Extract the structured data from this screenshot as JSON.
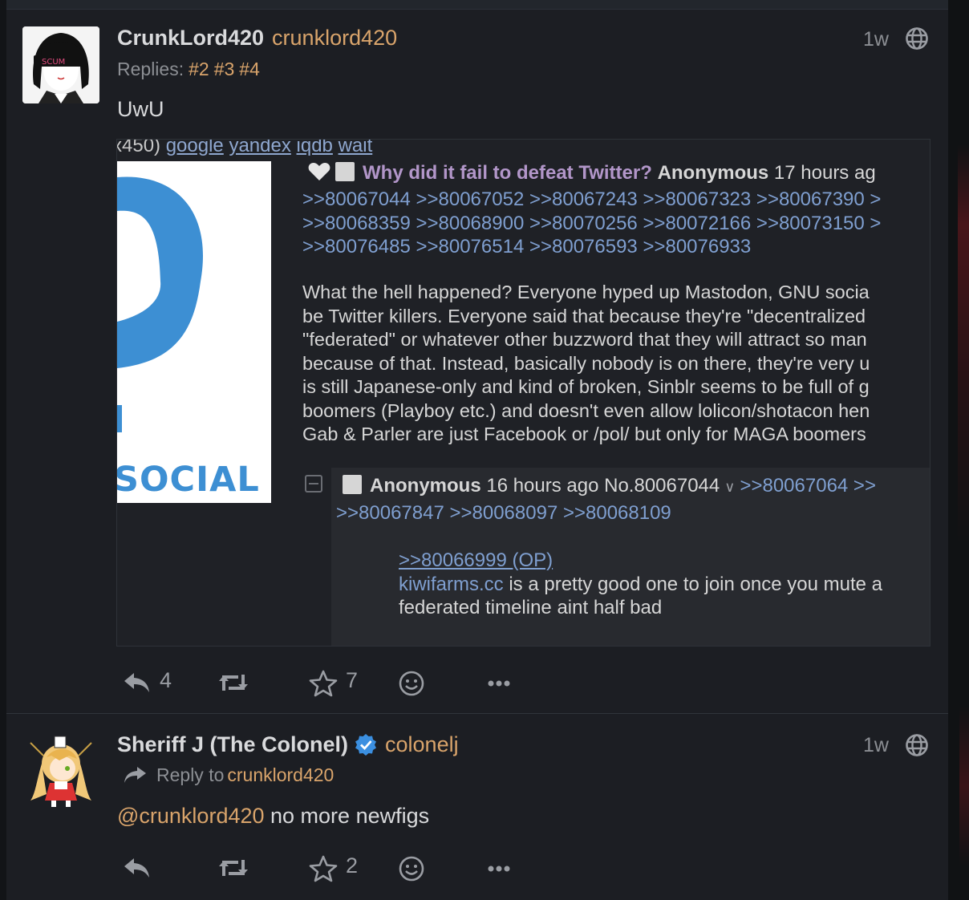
{
  "statuses": [
    {
      "display_name": "CrunkLord420",
      "acct": "crunklord420",
      "timestamp": "1w",
      "replies_label": "Replies:",
      "replies": [
        "#2",
        "#3",
        "#4"
      ],
      "content": "UwU",
      "avatar_text": "SCUM",
      "attachment": {
        "cropped_top": {
          "prefix": "x450) ",
          "links": [
            "google",
            "yandex",
            "iqdb",
            "wait"
          ]
        },
        "thumb_text": "SOCIAL",
        "subject": "Why did it fail to defeat Twitter?",
        "author": "Anonymous",
        "time": "17 hours ag",
        "quote_lines": [
          ">>80067044 >>80067052 >>80067243 >>80067323 >>80067390 >",
          ">>80068359 >>80068900 >>80070256 >>80072166 >>80073150 >",
          ">>80076485 >>80076514 >>80076593 >>80076933"
        ],
        "body_lines": [
          "What the hell happened? Everyone hyped up Mastodon, GNU socia",
          "be Twitter killers. Everyone said that because they're \"decentralized",
          "\"federated\" or whatever other buzzword that they will attract so man",
          "because of that. Instead, basically nobody is on there, they're very u",
          "is still Japanese-only and kind of broken, Sinblr seems to be full of g",
          "boomers (Playboy etc.) and doesn't even allow lolicon/shotacon hen",
          "Gab & Parler are just Facebook or /pol/ but only for MAGA boomers"
        ],
        "reply": {
          "author": "Anonymous",
          "time": "16 hours ago",
          "post_no": "No.80067044",
          "quote_inline": ">>80067064 >>",
          "quotes_line": ">>80067847 >>80068097 >>80068109",
          "op_link": ">>80066999 (OP)",
          "kiwi": "kiwifarms.cc",
          "body_line1_rest": " is a pretty good one to join once you mute a",
          "body_line2": "federated timeline aint half bad"
        }
      },
      "actions": {
        "replies": "4",
        "favourites": "7"
      }
    },
    {
      "display_name": "Sheriff J (The Colonel)",
      "acct": "colonelj",
      "timestamp": "1w",
      "reply_to_label": "Reply to",
      "reply_to_acct": "crunklord420",
      "mention": "@crunklord420",
      "content": " no more newfigs",
      "actions": {
        "replies": "",
        "favourites": "2"
      }
    }
  ],
  "colors": {
    "background": "#1c1e23",
    "text": "#d9dadc",
    "muted": "#8c8f94",
    "accent": "#d9a46b",
    "verified": "#3b8fe0"
  },
  "icons": [
    "globe-icon",
    "reply-icon",
    "boost-icon",
    "star-icon",
    "emoji-icon",
    "more-icon",
    "verified-icon",
    "reply-arrow-icon"
  ]
}
